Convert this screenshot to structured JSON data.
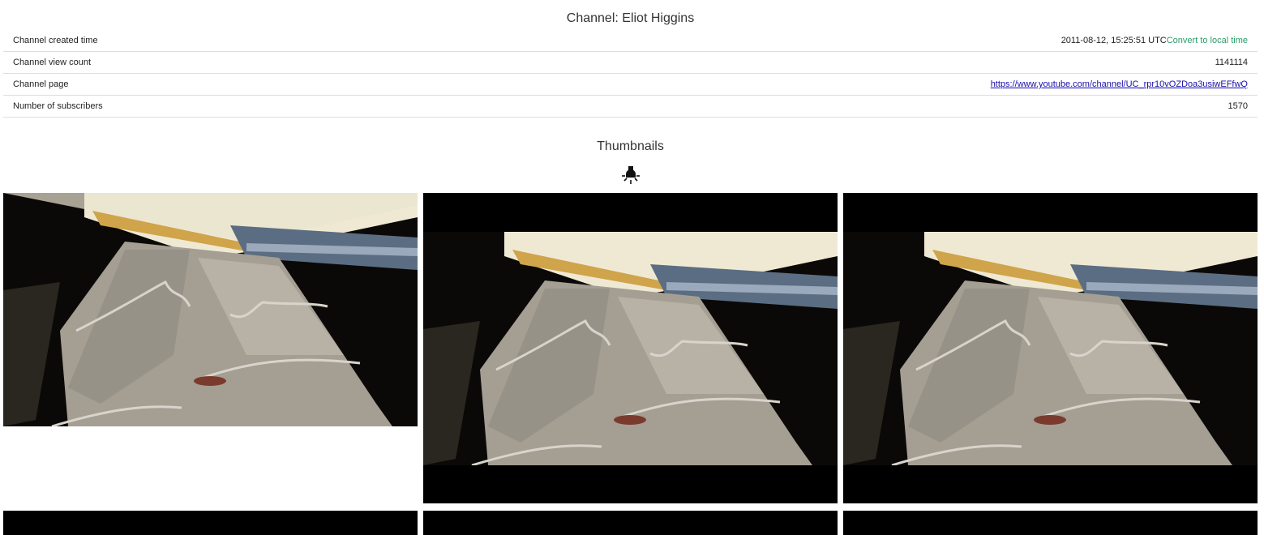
{
  "channel": {
    "title": "Channel: Eliot Higgins"
  },
  "info_rows": [
    {
      "label": "Channel created time",
      "value": "2011-08-12, 15:25:51 UTC",
      "link": "Convert to local time"
    },
    {
      "label": "Channel view count",
      "value": "1141114"
    },
    {
      "label": "Channel page",
      "value": "https://www.youtube.com/channel/UC_rpr10vOZDoa3usiwEFfwQ"
    },
    {
      "label": "Number of subscribers",
      "value": "1570"
    }
  ],
  "thumbnails": {
    "title": "Thumbnails",
    "toggle_icon": "lightbulb-icon",
    "items": [
      {
        "name": "thumbnail-1",
        "letterboxed": false
      },
      {
        "name": "thumbnail-2",
        "letterboxed": true
      },
      {
        "name": "thumbnail-3",
        "letterboxed": true
      },
      {
        "name": "thumbnail-4",
        "letterboxed": true
      },
      {
        "name": "thumbnail-5",
        "letterboxed": true
      },
      {
        "name": "thumbnail-6",
        "letterboxed": true
      }
    ]
  },
  "colors": {
    "link": "#1a0dab",
    "convert_link": "#2a9d6a",
    "row_border": "#dddddd"
  }
}
